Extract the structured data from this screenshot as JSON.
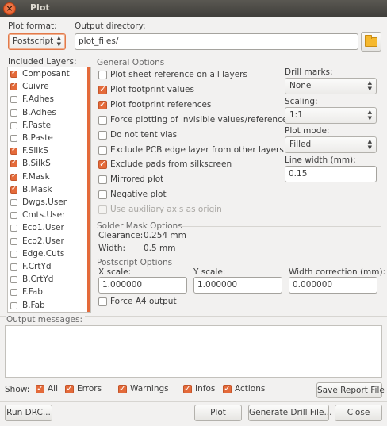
{
  "window": {
    "title": "Plot"
  },
  "plot_format": {
    "label": "Plot format:",
    "value": "Postscript"
  },
  "output_dir": {
    "label": "Output directory:",
    "value": "plot_files/"
  },
  "layers": {
    "title": "Included Layers:",
    "items": [
      {
        "label": "Composant",
        "checked": true
      },
      {
        "label": "Cuivre",
        "checked": true
      },
      {
        "label": "F.Adhes",
        "checked": false
      },
      {
        "label": "B.Adhes",
        "checked": false
      },
      {
        "label": "F.Paste",
        "checked": false
      },
      {
        "label": "B.Paste",
        "checked": false
      },
      {
        "label": "F.SilkS",
        "checked": true
      },
      {
        "label": "B.SilkS",
        "checked": true
      },
      {
        "label": "F.Mask",
        "checked": true
      },
      {
        "label": "B.Mask",
        "checked": true
      },
      {
        "label": "Dwgs.User",
        "checked": false
      },
      {
        "label": "Cmts.User",
        "checked": false
      },
      {
        "label": "Eco1.User",
        "checked": false
      },
      {
        "label": "Eco2.User",
        "checked": false
      },
      {
        "label": "Edge.Cuts",
        "checked": false
      },
      {
        "label": "F.CrtYd",
        "checked": false
      },
      {
        "label": "B.CrtYd",
        "checked": false
      },
      {
        "label": "F.Fab",
        "checked": false
      },
      {
        "label": "B.Fab",
        "checked": false
      }
    ]
  },
  "general": {
    "title": "General Options",
    "options": [
      {
        "label": "Plot sheet reference on all layers",
        "checked": false,
        "disabled": false
      },
      {
        "label": "Plot footprint values",
        "checked": true,
        "disabled": false
      },
      {
        "label": "Plot footprint references",
        "checked": true,
        "disabled": false
      },
      {
        "label": "Force plotting of invisible values/references",
        "checked": false,
        "disabled": false
      },
      {
        "label": "Do not tent vias",
        "checked": false,
        "disabled": false
      },
      {
        "label": "Exclude PCB edge layer from other layers",
        "checked": false,
        "disabled": false
      },
      {
        "label": "Exclude pads from silkscreen",
        "checked": true,
        "disabled": false
      },
      {
        "label": "Mirrored plot",
        "checked": false,
        "disabled": false
      },
      {
        "label": "Negative plot",
        "checked": false,
        "disabled": false
      },
      {
        "label": "Use auxiliary axis as origin",
        "checked": false,
        "disabled": true
      }
    ],
    "drill_marks": {
      "label": "Drill marks:",
      "value": "None"
    },
    "scaling": {
      "label": "Scaling:",
      "value": "1:1"
    },
    "plot_mode": {
      "label": "Plot mode:",
      "value": "Filled"
    },
    "line_width": {
      "label": "Line width (mm):",
      "value": "0.15"
    }
  },
  "solder_mask": {
    "title": "Solder Mask Options",
    "clearance_label": "Clearance:",
    "clearance_value": "0.254 mm",
    "width_label": "Width:",
    "width_value": "0.5 mm"
  },
  "postscript": {
    "title": "Postscript Options",
    "x_scale": {
      "label": "X scale:",
      "value": "1.000000"
    },
    "y_scale": {
      "label": "Y scale:",
      "value": "1.000000"
    },
    "width_correction": {
      "label": "Width correction (mm):",
      "value": "0.000000"
    },
    "force_a4": {
      "label": "Force A4 output",
      "checked": false
    }
  },
  "messages": {
    "title": "Output messages:"
  },
  "show": {
    "label": "Show:",
    "filters": [
      {
        "label": "All",
        "checked": true
      },
      {
        "label": "Errors",
        "checked": true
      },
      {
        "label": "Warnings",
        "checked": true
      },
      {
        "label": "Infos",
        "checked": true
      },
      {
        "label": "Actions",
        "checked": true
      }
    ],
    "save_report": "Save Report File"
  },
  "buttons": {
    "run_drc": "Run DRC...",
    "plot": "Plot",
    "generate_drill": "Generate Drill File...",
    "close": "Close"
  },
  "colors": {
    "accent": "#e46a3a",
    "titlebar": "#3e3d39",
    "window_bg": "#f2f1f0"
  }
}
